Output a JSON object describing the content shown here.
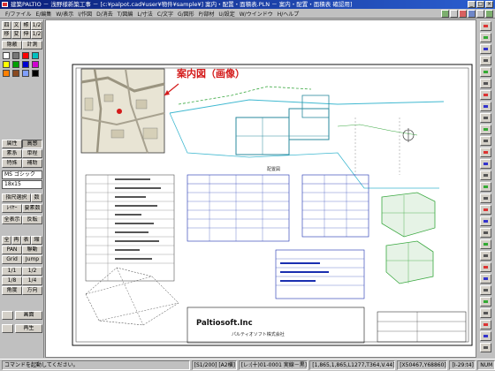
{
  "titlebar": {
    "title": "建築PALTIO － 浅野様新築工事 － [c:¥palpot.cad¥user¥物件¥sample¥]  案内・配置・面積表.PLN － 案内・配置・面積表  確認用]",
    "buttons": [
      "_",
      "□",
      "×"
    ]
  },
  "menu": [
    "F/ファイル",
    "E/編集",
    "W/表示",
    "I/作図",
    "D/消去",
    "T/図編",
    "L/寸法",
    "C/文字",
    "G/図形",
    "P/部材",
    "U/設定",
    "W/ウインドウ",
    "H/ヘルプ"
  ],
  "left_panel": {
    "row1": [
      "四",
      "文",
      "帳",
      "1/2"
    ],
    "row2": [
      "移",
      "変",
      "伸",
      "1/2"
    ],
    "row3": [
      "隠蔽",
      "計測"
    ],
    "row4": [
      "属性",
      "高感"
    ],
    "row5": [
      "素系",
      "単程"
    ],
    "row6": [
      "特殊",
      "補助"
    ],
    "font_name": "MS ゴシック",
    "font_size": "18x15",
    "row7": [
      "指尺選択",
      "数"
    ],
    "row8": [
      "ﾚｲﾔｰ",
      "要素数"
    ],
    "row9": [
      "全表示",
      "反転"
    ],
    "row10": [
      "全",
      "再",
      "表",
      "縮"
    ],
    "row11": [
      "PAN",
      "聯動"
    ],
    "row12": [
      "Grid",
      "Jump"
    ],
    "row13": [
      "1/1",
      "1/2"
    ],
    "row14": [
      "1/8",
      "1/4"
    ],
    "row15": [
      "角度",
      "方向"
    ],
    "row16": [
      "",
      "画面"
    ],
    "row17": [
      "",
      "再生"
    ]
  },
  "drawing": {
    "annotation": "案内図（画像）",
    "company_name": "Paltiosoft.Inc",
    "company_sub": "パルティオソフト株式会社"
  },
  "status": {
    "message": "コマンドを起動してください。",
    "scale": "[S1/200] [A2横]",
    "layer": "[レ:(十)01-0001  実線－黒]",
    "coords": "[1,865,1,865,L1277,T364,V.44]",
    "cursor": "[X50467,Y68860]",
    "right_info": "[I-29:t4]",
    "mode": "NUM"
  },
  "colors": {
    "titlebar_start": "#0a1f7a",
    "titlebar_end": "#2b5fd0",
    "annotation_red": "#d41a1a",
    "plan_cyan": "#3fb8d0",
    "plan_green": "#3aa840",
    "table_blue": "#1a2fb0"
  }
}
